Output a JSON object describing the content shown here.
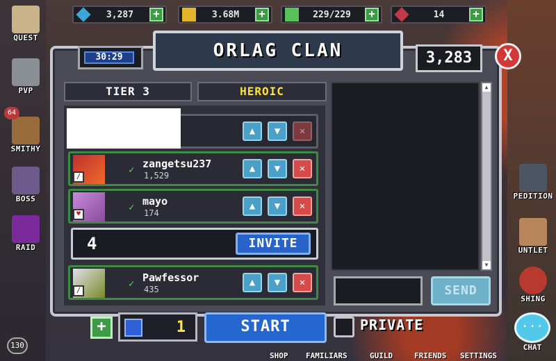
{
  "resources": [
    {
      "name": "gems",
      "value": "3,287",
      "icon": "blue-gem-icon",
      "color": "#3aa7d8"
    },
    {
      "name": "gold",
      "value": "3.68M",
      "icon": "gold-coin-icon",
      "color": "#e4b52a"
    },
    {
      "name": "energy",
      "value": "229/229",
      "icon": "energy-bar-icon",
      "color": "#5ac15a"
    },
    {
      "name": "red-gems",
      "value": "14",
      "icon": "red-gem-icon",
      "color": "#c23a4a"
    }
  ],
  "sidebar_left": [
    {
      "label": "QUEST",
      "icon": "quest-scroll-icon"
    },
    {
      "label": "PVP",
      "icon": "crossed-swords-icon"
    },
    {
      "label": "SMITHY",
      "icon": "anvil-icon",
      "badge": "64"
    },
    {
      "label": "BOSS",
      "icon": "boss-skull-icon"
    },
    {
      "label": "RAID",
      "icon": "purple-crystal-icon"
    }
  ],
  "sidebar_right": [
    {
      "label": "PEDITION",
      "icon": "expedition-icon"
    },
    {
      "label": "UNTLET",
      "icon": "gauntlet-icon"
    },
    {
      "label": "SHING",
      "icon": "fishing-icon"
    }
  ],
  "panel": {
    "title": "ORLAG CLAN",
    "timer": "30:29",
    "gems": "3,283",
    "close": "X",
    "tier": "TIER 3",
    "difficulty": "HEROIC",
    "send": "SEND"
  },
  "slots": [
    {
      "name": "zangetsu237",
      "power": "1,529"
    },
    {
      "name": "mayo",
      "power": "174"
    },
    {
      "name": "Pawfessor",
      "power": "435"
    }
  ],
  "open_slot": {
    "number": "4",
    "invite": "INVITE"
  },
  "bottom": {
    "tickets": "1",
    "start": "START",
    "private": "PRIVATE",
    "chat": "CHAT",
    "level": "130",
    "nav": [
      "SHOP",
      "FAMILIARS",
      "GUILD",
      "FRIENDS",
      "SETTINGS"
    ]
  },
  "colors": {
    "heroic": "#ffe233",
    "accent": "#2566d1",
    "ready": "#5dd65d"
  }
}
